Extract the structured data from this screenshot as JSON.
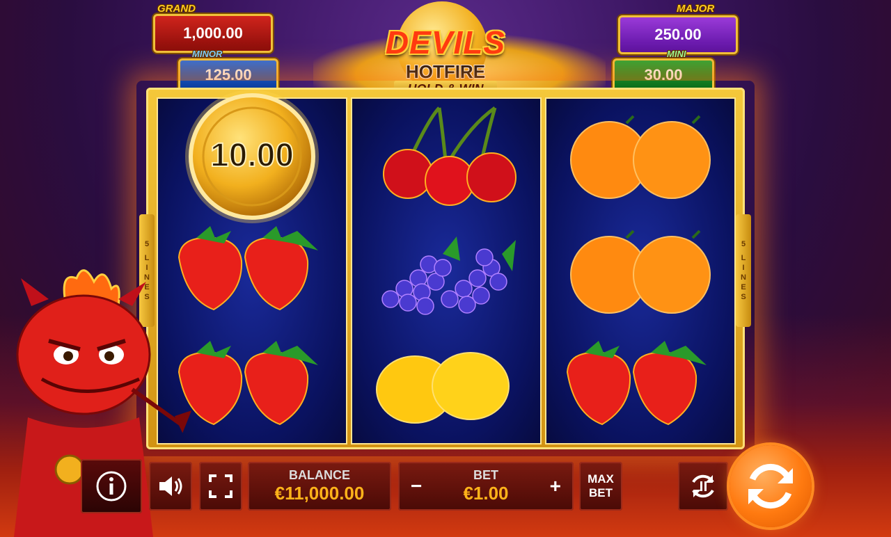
{
  "jackpots": {
    "grand": {
      "label": "GRAND",
      "value": "1,000.00"
    },
    "major": {
      "label": "MAJOR",
      "value": "250.00"
    },
    "minor": {
      "label": "MINOR",
      "value": "125.00"
    },
    "mini": {
      "label": "MINI",
      "value": "30.00"
    }
  },
  "logo": {
    "line1": "DEVILS",
    "line2": "HOTFIRE",
    "line3": "HOLD & WIN"
  },
  "lines": {
    "count": "5",
    "word": "LINES"
  },
  "reels": [
    [
      "coin",
      "strawberry",
      "strawberry"
    ],
    [
      "cherry",
      "grape",
      "lemon"
    ],
    [
      "orange",
      "orange",
      "strawberry"
    ]
  ],
  "coin_value": "10.00",
  "controls": {
    "balance_label": "BALANCE",
    "balance_value": "€11,000.00",
    "bet_label": "BET",
    "bet_value": "€1.00",
    "bet_minus": "−",
    "bet_plus": "+",
    "maxbet_line1": "MAX",
    "maxbet_line2": "BET"
  },
  "icons": {
    "info": "info-icon",
    "sound": "speaker-icon",
    "fullscreen": "fullscreen-icon",
    "autoplay": "autoplay-icon",
    "spin": "spin-icon"
  },
  "colors": {
    "accent": "#ffb31a",
    "spin": "#ff7a10",
    "reel_bg": "#0a1260",
    "frame": "#f5c83a"
  }
}
